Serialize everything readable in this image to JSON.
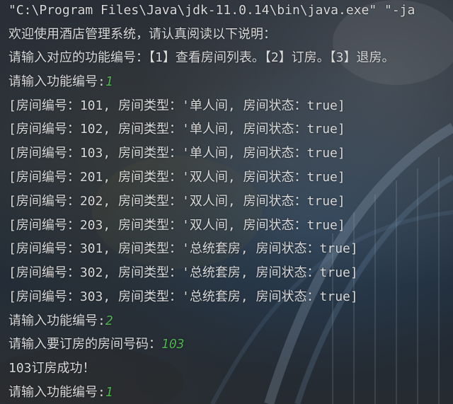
{
  "console": {
    "command_line": "\"C:\\Program Files\\Java\\jdk-11.0.14\\bin\\java.exe\" \"-ja",
    "welcome": "欢迎使用酒店管理系统，请认真阅读以下说明：",
    "instructions": "请输入对应的功能编号：【1】查看房间列表。【2】订房。【3】退房。",
    "prompt_1": "请输入功能编号:",
    "input_1": "1",
    "rooms": [
      "[房间编号：101, 房间类型：'单人间, 房间状态：true]",
      "[房间编号：102, 房间类型：'单人间, 房间状态：true]",
      "[房间编号：103, 房间类型：'单人间, 房间状态：true]",
      "[房间编号：201, 房间类型：'双人间, 房间状态：true]",
      "[房间编号：202, 房间类型：'双人间, 房间状态：true]",
      "[房间编号：203, 房间类型：'双人间, 房间状态：true]",
      "[房间编号：301, 房间类型：'总统套房, 房间状态：true]",
      "[房间编号：302, 房间类型：'总统套房, 房间状态：true]",
      "[房间编号：303, 房间类型：'总统套房, 房间状态：true]"
    ],
    "prompt_2": "请输入功能编号:",
    "input_2": "2",
    "prompt_room": "请输入要订房的房间号码：",
    "input_room": "103",
    "success": "103订房成功！",
    "prompt_3": "请输入功能编号:",
    "input_3": "1"
  },
  "colors": {
    "text": "#d9d9d9",
    "user_input": "#4fb34f",
    "background": "#242a33"
  }
}
